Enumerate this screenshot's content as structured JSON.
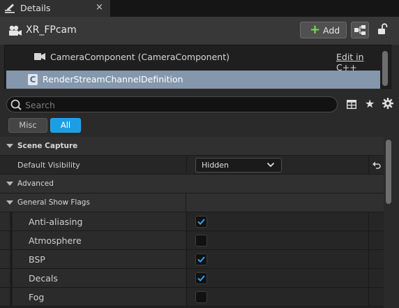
{
  "tab": {
    "title": "Details",
    "close_glyph": "×"
  },
  "header": {
    "actor_name": "XR_FPcam",
    "add_label": "Add",
    "add_glyph": "+"
  },
  "tree": {
    "component_label": "CameraComponent (CameraComponent)",
    "edit_link": "Edit in C++",
    "class_label": "RenderStreamChannelDefinition",
    "class_glyph": "C"
  },
  "search": {
    "placeholder": "Search",
    "value": ""
  },
  "filters": {
    "misc": "Misc",
    "all": "All",
    "active": "All"
  },
  "properties": {
    "scene_capture": "Scene Capture",
    "default_visibility_label": "Default Visibility",
    "default_visibility_value": "Hidden",
    "advanced": "Advanced",
    "general_show_flags": "General Show Flags",
    "flags": [
      {
        "label": "Anti-aliasing",
        "checked": true
      },
      {
        "label": "Atmosphere",
        "checked": false
      },
      {
        "label": "BSP",
        "checked": true
      },
      {
        "label": "Decals",
        "checked": true
      },
      {
        "label": "Fog",
        "checked": false
      }
    ]
  },
  "icons": {
    "tab": "edit-pencil-icon",
    "actor": "camera-actor-icon",
    "blueprint": "blueprint-icon",
    "lock": "unlock-icon",
    "camera": "camera-component-icon",
    "class": "cpp-class-icon",
    "search": "search-icon",
    "grid": "property-matrix-icon",
    "star": "favorites-star-icon",
    "gear": "settings-gear-icon",
    "reset": "reset-to-default-icon"
  },
  "colors": {
    "accent": "#1a9fe6",
    "selection": "#8497ad",
    "add_green": "#7fd957",
    "check_blue": "#2ea8f0"
  }
}
